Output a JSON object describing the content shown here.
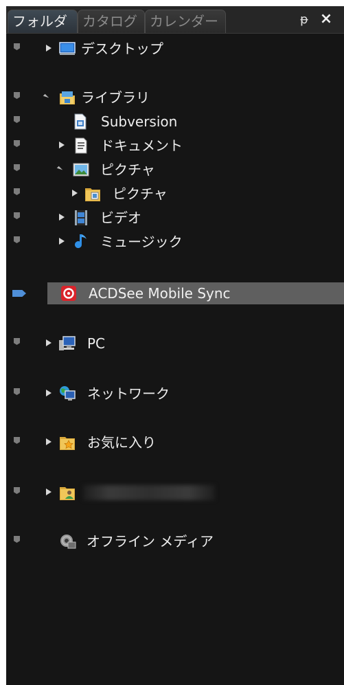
{
  "tabs": [
    {
      "label": "フォルダ",
      "active": true
    },
    {
      "label": "カタログ",
      "active": false
    },
    {
      "label": "カレンダー",
      "active": false
    }
  ],
  "window_controls": {
    "pin": "ᵽ",
    "close": "×"
  },
  "tree": {
    "desktop": {
      "label": "デスクトップ",
      "icon": "desktop-icon"
    },
    "library": {
      "label": "ライブラリ",
      "icon": "library-icon"
    },
    "subversion": {
      "label": "Subversion",
      "icon": "document-icon"
    },
    "documents": {
      "label": "ドキュメント",
      "icon": "documents-icon"
    },
    "pictures": {
      "label": "ピクチャ",
      "icon": "pictures-icon"
    },
    "pictures_folder": {
      "label": "ピクチャ",
      "icon": "pictures-folder-icon"
    },
    "videos": {
      "label": "ビデオ",
      "icon": "video-icon"
    },
    "music": {
      "label": "ミュージック",
      "icon": "music-note-icon"
    },
    "acdsee_sync": {
      "label": "ACDSee Mobile Sync",
      "icon": "acdsee-sync-icon",
      "selected": true
    },
    "pc": {
      "label": "PC",
      "icon": "computer-icon"
    },
    "network": {
      "label": "ネットワーク",
      "icon": "network-icon"
    },
    "favorites": {
      "label": "お気に入り",
      "icon": "favorites-folder-icon"
    },
    "user": {
      "label": "",
      "icon": "user-folder-icon"
    },
    "offline": {
      "label": "オフライン メディア",
      "icon": "offline-media-icon"
    }
  },
  "colors": {
    "panel_bg": "#151515",
    "selection_bg": "#5f5f5f",
    "selection_marker": "#4f8fd8",
    "acdsee_red": "#d9242b"
  }
}
